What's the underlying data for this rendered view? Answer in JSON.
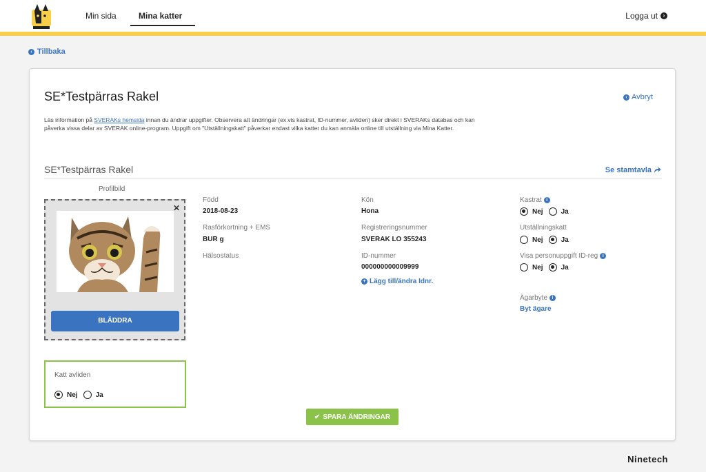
{
  "nav": {
    "items": [
      "Min sida",
      "Mina katter"
    ],
    "active": "Mina katter",
    "logout": "Logga ut"
  },
  "back_label": "Tillbaka",
  "card": {
    "title": "SE*Testpärras Rakel",
    "cancel_label": "Avbryt",
    "info": {
      "prefix": "Läs information på ",
      "link": "SVERAKs hemsida",
      "suffix": " innan du ändrar uppgifter. Observera att ändringar (ex.vis kastrat, ID-nummer, avliden) sker direkt i SVERAKs databas och kan påverka vissa delar av SVERAK online-program. Uppgift om \"Utställningskatt\" påverkar endast vilka katter du kan anmäla online till utställning via Mina Katter."
    },
    "section_title": "SE*Testpärras Rakel",
    "stamtavla_label": "Se stamtavla",
    "profile_label": "Profilbild",
    "browse_label": "BLÄDDRA",
    "deceased": {
      "label": "Katt avliden",
      "selected": "Nej"
    },
    "fields": {
      "born": {
        "label": "Född",
        "value": "2018-08-23"
      },
      "breed": {
        "label": "Rasförkortning + EMS",
        "value": "BUR g"
      },
      "health": {
        "label": "Hälsostatus",
        "value": ""
      },
      "sex": {
        "label": "Kön",
        "value": "Hona"
      },
      "reg": {
        "label": "Registreringsnummer",
        "value": "SVERAK LO 355243"
      },
      "id": {
        "label": "ID-nummer",
        "value": "000000000009999"
      },
      "id_link": "Lägg till/ändra Idnr."
    },
    "options": {
      "kastrat": {
        "label": "Kastrat",
        "selected": "Nej"
      },
      "utstallning": {
        "label": "Utställningskatt",
        "selected": "Ja"
      },
      "visa": {
        "label": "Visa personuppgift ID-reg",
        "selected": "Ja"
      },
      "agarbyte": {
        "label": "Ägarbyte",
        "link": "Byt ägare"
      }
    },
    "radio_labels": {
      "no": "Nej",
      "yes": "Ja"
    },
    "save_label": "SPARA ÄNDRINGAR"
  },
  "footer_brand": "Ninetech",
  "colors": {
    "accent": "#3a74c1",
    "stripe": "#f7cf4a",
    "success": "#8bc34a"
  }
}
